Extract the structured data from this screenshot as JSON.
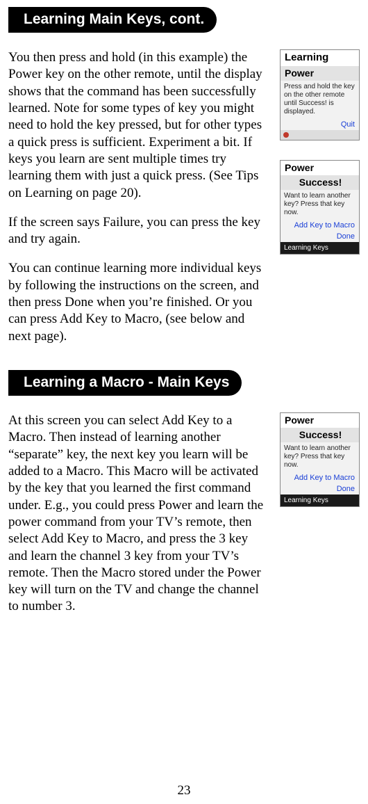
{
  "headers": {
    "h1": "Learning Main Keys, cont.",
    "h2": "Learning a Macro - Main Keys"
  },
  "paras": {
    "p1": "You then press and hold (in this example) the Power key on the other remote, until the display shows that the command has been successfully learned. Note for some types of key you might need to hold the key pressed, but for other types a quick press is sufficient. Experiment a bit. If keys you learn are sent multiple times try learning them with just a quick press. (See Tips on Learning on page 20).",
    "p2": "If the screen says Failure, you can press the key and try again.",
    "p3": "You can continue learning more individual keys by following the instructions on the screen, and then press Done when you’re finished. Or you can press Add Key to Macro, (see below and next page).",
    "p4": "At this screen you can select Add Key to a Macro. Then instead of learning another “separate” key, the next key you learn will be added to a Macro. This Macro will be activated by the key that you learned the first command under. E.g., you could press Power and learn the power command from your TV’s remote, then select Add Key to Macro, and press the 3 key and learn the channel 3 key from your TV’s remote. Then the Macro stored under the Power key will turn on the TV and change the channel to number 3."
  },
  "shots": {
    "s1": {
      "title": "Learning",
      "subtitle": "Power",
      "body": "Press and hold the key on the other remote until Success! is displayed.",
      "quit": "Quit"
    },
    "s2": {
      "title": "Power",
      "subtitle": "Success!",
      "body": "Want to learn another key? Press that key now.",
      "add": "Add Key to Macro",
      "done": "Done",
      "footer": "Learning Keys"
    },
    "s3": {
      "title": "Power",
      "subtitle": "Success!",
      "body": "Want to learn another key? Press that key now.",
      "add": "Add Key to Macro",
      "done": "Done",
      "footer": "Learning Keys"
    }
  },
  "page_number": "23"
}
